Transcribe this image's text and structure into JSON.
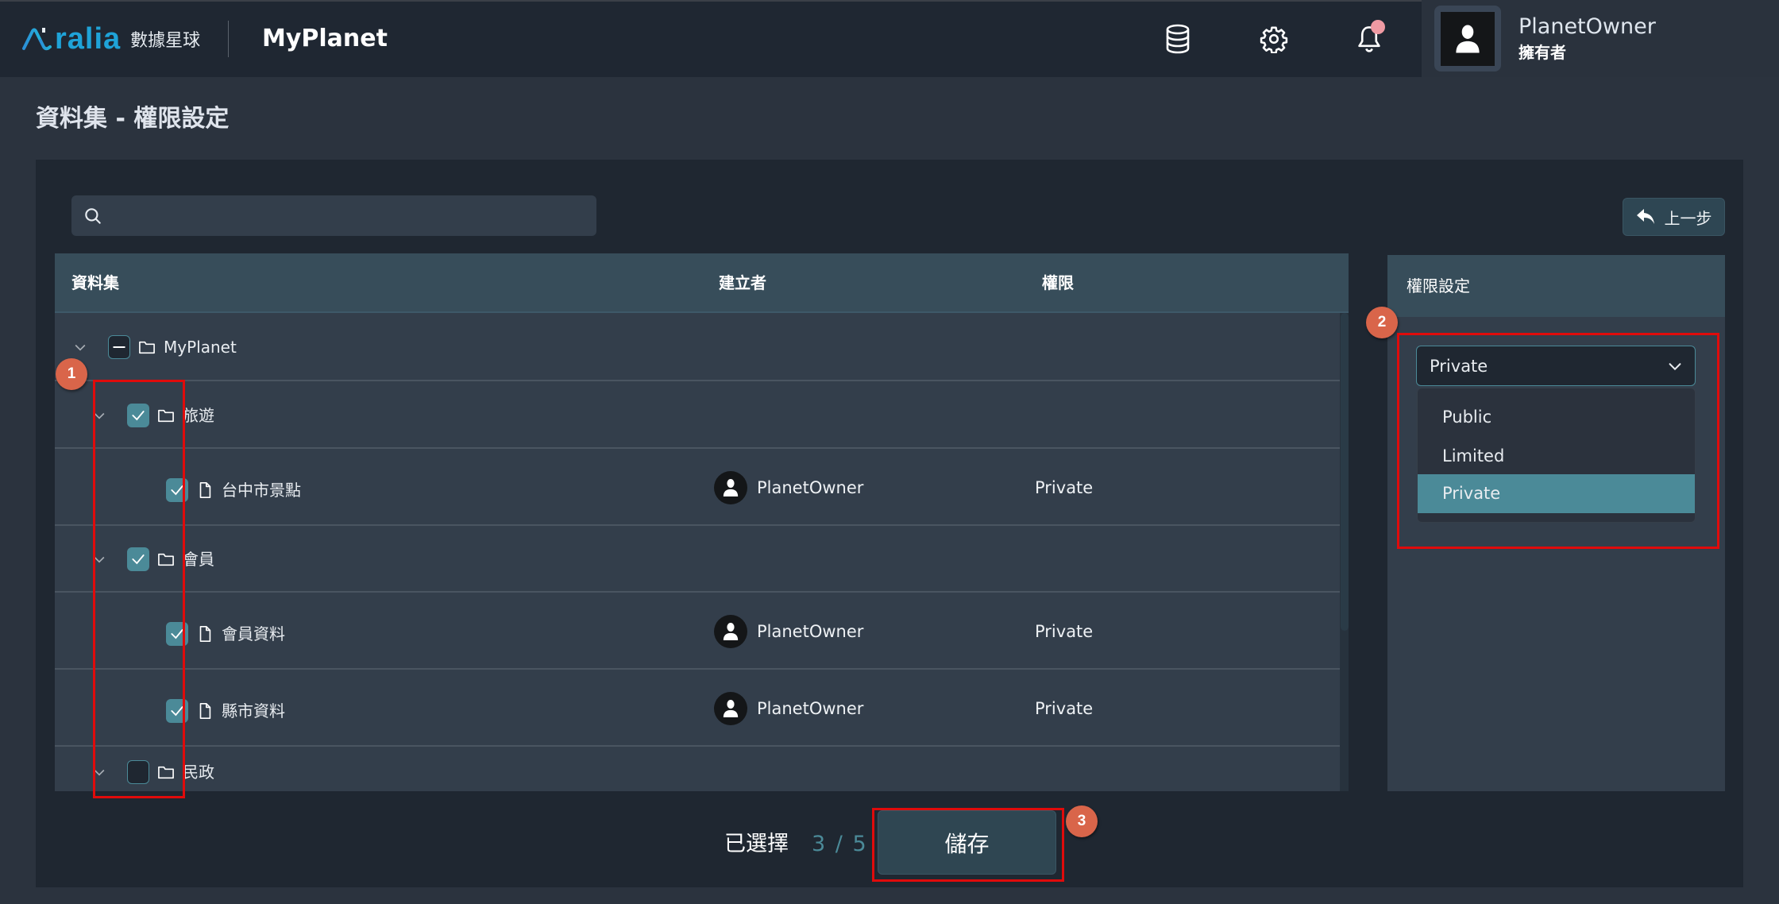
{
  "header": {
    "logo_text": "ralia",
    "logo_cn": "數據星球",
    "app_title": "MyPlanet",
    "icons": [
      "database-icon",
      "gear-icon",
      "bell-icon"
    ],
    "notification_dot_color": "#ef9aa3",
    "user": {
      "name": "PlanetOwner",
      "role": "擁有者"
    }
  },
  "page": {
    "title": "資料集 - 權限設定"
  },
  "search": {
    "placeholder": "",
    "value": ""
  },
  "back_button": {
    "label": "上一步",
    "icon": "reply-arrow-icon"
  },
  "table": {
    "columns": [
      "資料集",
      "建立者",
      "權限"
    ],
    "rows": [
      {
        "level": 0,
        "type": "folder",
        "expandable": true,
        "check": "partial",
        "name": "MyPlanet",
        "creator": "",
        "permission": ""
      },
      {
        "level": 1,
        "type": "folder",
        "expandable": true,
        "check": "checked",
        "name": "旅遊",
        "creator": "",
        "permission": ""
      },
      {
        "level": 2,
        "type": "file",
        "expandable": false,
        "check": "checked",
        "name": "台中市景點",
        "creator": "PlanetOwner",
        "permission": "Private"
      },
      {
        "level": 1,
        "type": "folder",
        "expandable": true,
        "check": "checked",
        "name": "會員",
        "creator": "",
        "permission": ""
      },
      {
        "level": 2,
        "type": "file",
        "expandable": false,
        "check": "checked",
        "name": "會員資料",
        "creator": "PlanetOwner",
        "permission": "Private"
      },
      {
        "level": 2,
        "type": "file",
        "expandable": false,
        "check": "checked",
        "name": "縣市資料",
        "creator": "PlanetOwner",
        "permission": "Private"
      },
      {
        "level": 1,
        "type": "folder",
        "expandable": true,
        "check": "unchecked",
        "name": "民政",
        "creator": "",
        "permission": ""
      }
    ]
  },
  "permission_panel": {
    "title": "權限設定",
    "selected": "Private",
    "options": [
      "Public",
      "Limited",
      "Private"
    ],
    "highlighted_option": "Private"
  },
  "footer": {
    "selected_label": "已選擇",
    "selected_count": "3 / 5",
    "save_label": "儲存"
  },
  "annotations": [
    {
      "number": "1",
      "target": "row checkboxes"
    },
    {
      "number": "2",
      "target": "permission dropdown"
    },
    {
      "number": "3",
      "target": "save button"
    }
  ],
  "colors": {
    "accent": "#4b8a98",
    "annotation_badge": "#d9654a",
    "annotation_box": "#e00b0b",
    "logo": "#1fa3d8"
  }
}
